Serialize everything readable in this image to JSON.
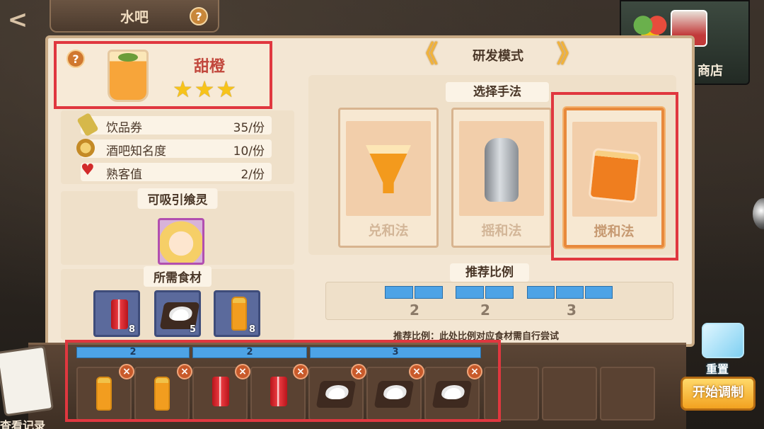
{
  "top": {
    "title": "水吧",
    "help": "?",
    "back": "<"
  },
  "shop": {
    "label": "商店"
  },
  "drink": {
    "help": "?",
    "name": "甜橙",
    "stars": [
      "★",
      "★",
      "★"
    ]
  },
  "stats": [
    {
      "label": "饮品券",
      "value": "35/份",
      "icon": "ticket-icon"
    },
    {
      "label": "酒吧知名度",
      "value": "10/份",
      "icon": "coin-icon"
    },
    {
      "label": "熟客值",
      "value": "2/份",
      "icon": "heart-icon"
    }
  ],
  "attract": {
    "title": "可吸引飨灵"
  },
  "ingredients": {
    "title": "所需食材",
    "items": [
      {
        "name": "cola",
        "count": "8"
      },
      {
        "name": "sugar",
        "count": "5"
      },
      {
        "name": "orange-juice",
        "count": "8"
      }
    ]
  },
  "mode": {
    "title": "研发模式",
    "prev": "《",
    "next": "》"
  },
  "method": {
    "title": "选择手法",
    "options": [
      {
        "label": "兑和法",
        "selected": false
      },
      {
        "label": "摇和法",
        "selected": false
      },
      {
        "label": "搅和法",
        "selected": true
      }
    ]
  },
  "ratio": {
    "title": "推荐比例",
    "groups": [
      "2",
      "2",
      "3"
    ],
    "note": "推荐比例：此处比例对应食材需自行尝试"
  },
  "bottom": {
    "ratios": [
      "2",
      "2",
      "3"
    ],
    "slots": [
      "orange-juice",
      "orange-juice",
      "cola",
      "cola",
      "sugar",
      "sugar",
      "sugar",
      "",
      "",
      "",
      ""
    ],
    "remove": "×",
    "history": "查看记录",
    "reset": "重置",
    "start": "开始调制"
  },
  "colors": {
    "highlight": "#e0373f",
    "accent": "#f2a220",
    "ratio_blue": "#4da3e6"
  }
}
